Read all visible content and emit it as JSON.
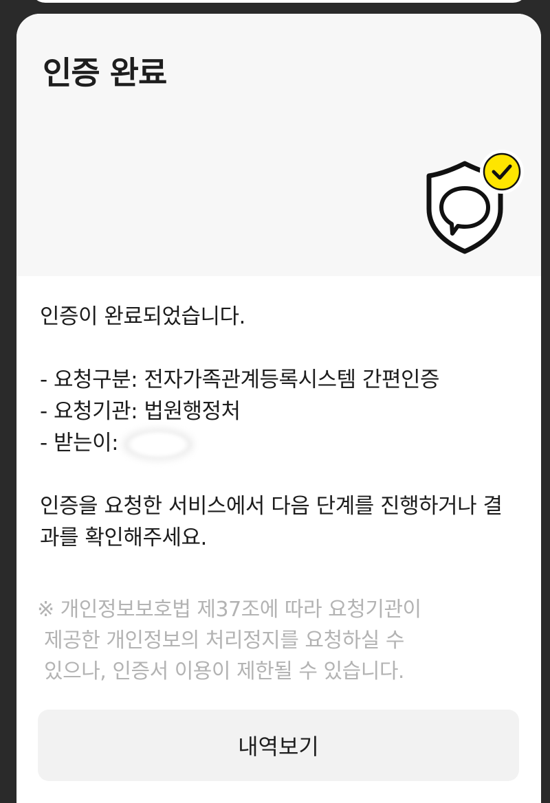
{
  "header": {
    "title": "인증 완료",
    "icon": "shield-chat-check-icon",
    "accent_color": "#FEE500"
  },
  "body": {
    "intro": "인증이 완료되었습니다.",
    "request_type": "- 요청구분: 전자가족관계등록시스템 간편인증",
    "request_org": "- 요청기관: 법원행정처",
    "recipient_label": "- 받는이:",
    "instructions": "인증을 요청한 서비스에서 다음 단계를 진행하거나 결과를 확인해주세요."
  },
  "notice": {
    "line1": "※ 개인정보보호법 제37조에 따라 요청기관이",
    "line2": "제공한 개인정보의 처리정지를 요청하실 수",
    "line3": "있으나, 인증서 이용이 제한될 수 있습니다."
  },
  "actions": {
    "history_button": "내역보기"
  }
}
